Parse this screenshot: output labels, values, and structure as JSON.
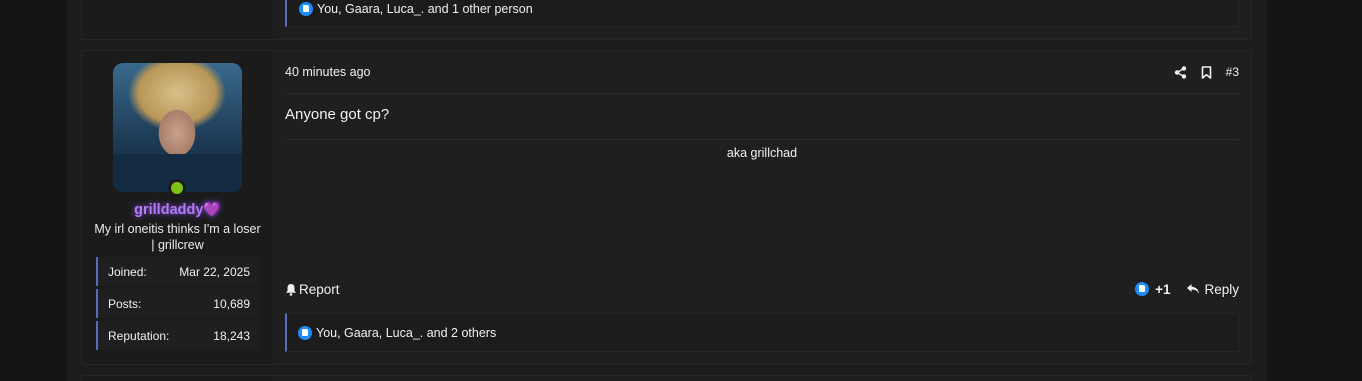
{
  "previous_post": {
    "likes_text": "You, Gaara, Luca_. and 1 other person"
  },
  "post": {
    "user": {
      "username": "grilldaddy",
      "username_emoji": "💜",
      "title": "My irl oneitis thinks I'm a loser | grillcrew",
      "online": true,
      "stats": [
        {
          "label": "Joined:",
          "value": "Mar 22, 2025"
        },
        {
          "label": "Posts:",
          "value": "10,689"
        },
        {
          "label": "Reputation:",
          "value": "18,243"
        }
      ]
    },
    "date": "40 minutes ago",
    "post_number": "#3",
    "body": "Anyone got cp?",
    "signature": "aka grillchad",
    "report_label": "Report",
    "reaction_score": "+1",
    "reply_label": "Reply",
    "likes_text": "You, Gaara, Luca_. and 2 others"
  },
  "colors": {
    "background": "#141414",
    "post_background": "#1f1f1f",
    "accent_border": "#5c6bc0",
    "username": "#b07cf2",
    "online": "#7cc21a",
    "like": "#1d8cf8"
  },
  "icons": [
    "thumbs-up-icon",
    "share-icon",
    "bookmark-icon",
    "bell-icon",
    "reply-icon"
  ]
}
